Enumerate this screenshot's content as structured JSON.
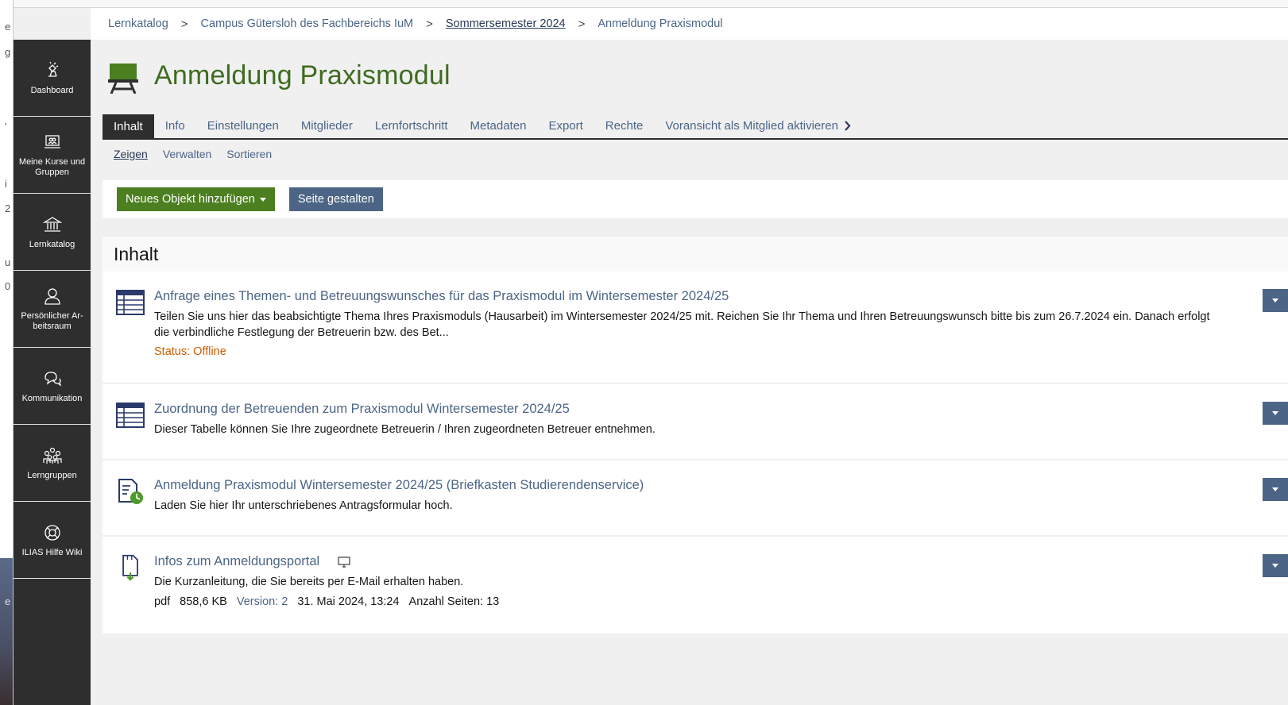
{
  "background_letters": [
    "e",
    "g",
    "'",
    "i",
    "2",
    "u",
    "0",
    "e"
  ],
  "breadcrumb": [
    {
      "label": "Lernkatalog"
    },
    {
      "label": "Campus Gütersloh des Fachbereichs IuM"
    },
    {
      "label": "Sommersemester 2024"
    },
    {
      "label": "Anmeldung Praxismodul"
    }
  ],
  "breadcrumb_separator": ">",
  "sidebar": {
    "items": [
      {
        "label": "Dashboard",
        "icon": "dashboard-icon"
      },
      {
        "label": "Meine Kurse und Gruppen",
        "icon": "courses-icon"
      },
      {
        "label": "Lernkatalog",
        "icon": "catalog-icon"
      },
      {
        "label": "Persönlicher Ar-beitsraum",
        "icon": "person-icon"
      },
      {
        "label": "Kommunikation",
        "icon": "chat-icon"
      },
      {
        "label": "Lerngruppen",
        "icon": "group-icon"
      },
      {
        "label": "ILIAS Hilfe Wiki",
        "icon": "lifebuoy-icon"
      }
    ]
  },
  "page": {
    "title": "Anmeldung Praxismodul",
    "title_icon": "course-easel-icon"
  },
  "tabs": [
    {
      "label": "Inhalt",
      "active": true
    },
    {
      "label": "Info"
    },
    {
      "label": "Einstellungen"
    },
    {
      "label": "Mitglieder"
    },
    {
      "label": "Lernfortschritt"
    },
    {
      "label": "Metadaten"
    },
    {
      "label": "Export"
    },
    {
      "label": "Rechte"
    },
    {
      "label": "Voransicht als Mitglied aktivieren"
    }
  ],
  "subtabs": [
    {
      "label": "Zeigen",
      "active": true
    },
    {
      "label": "Verwalten"
    },
    {
      "label": "Sortieren"
    }
  ],
  "toolbar": {
    "add_label": "Neues Objekt hinzufügen",
    "design_label": "Seite gestalten"
  },
  "panel": {
    "heading": "Inhalt",
    "items": [
      {
        "icon": "table-icon",
        "title": "Anfrage eines Themen- und Betreuungswunsches für das Praxismodul im Wintersemester 2024/25",
        "description": "Teilen Sie uns hier das beabsichtigte Thema Ihres Praxismoduls (Hausarbeit) im Wintersemester 2024/25 mit. Reichen Sie Ihr Thema und Ihren Betreuungswunsch bitte bis zum 26.7.2024 ein. Danach erfolgt die verbindliche Festlegung der Betreuerin bzw. des Bet...",
        "status": "Status: Offline"
      },
      {
        "icon": "table-icon",
        "title": "Zuordnung der Betreuenden zum Praxismodul Wintersemester 2024/25",
        "description": "Dieser Tabelle können Sie Ihre zugeordnete Betreuerin / Ihren zugeordneten Betreuer entnehmen."
      },
      {
        "icon": "exercise-clock-icon",
        "title": "Anmeldung Praxismodul Wintersemester 2024/25 (Briefkasten Studierendenservice)",
        "description": "Laden Sie hier Ihr unterschriebenes Antragsformular hoch."
      },
      {
        "icon": "file-download-icon",
        "title": "Infos zum Anmeldungsportal",
        "description": "Die Kurzanleitung, die Sie bereits per E-Mail erhalten haben.",
        "props": {
          "type": "pdf",
          "size": "858,6 KB",
          "version": "Version: 2",
          "date": "31. Mai 2024, 13:24",
          "pages": "Anzahl Seiten: 13"
        }
      }
    ]
  },
  "colors": {
    "sidebar_bg": "#2e2e2e",
    "link": "#4c6586",
    "title_green": "#3f6b20",
    "primary_button": "#4c7f20",
    "status_offline": "#cb5d00"
  }
}
